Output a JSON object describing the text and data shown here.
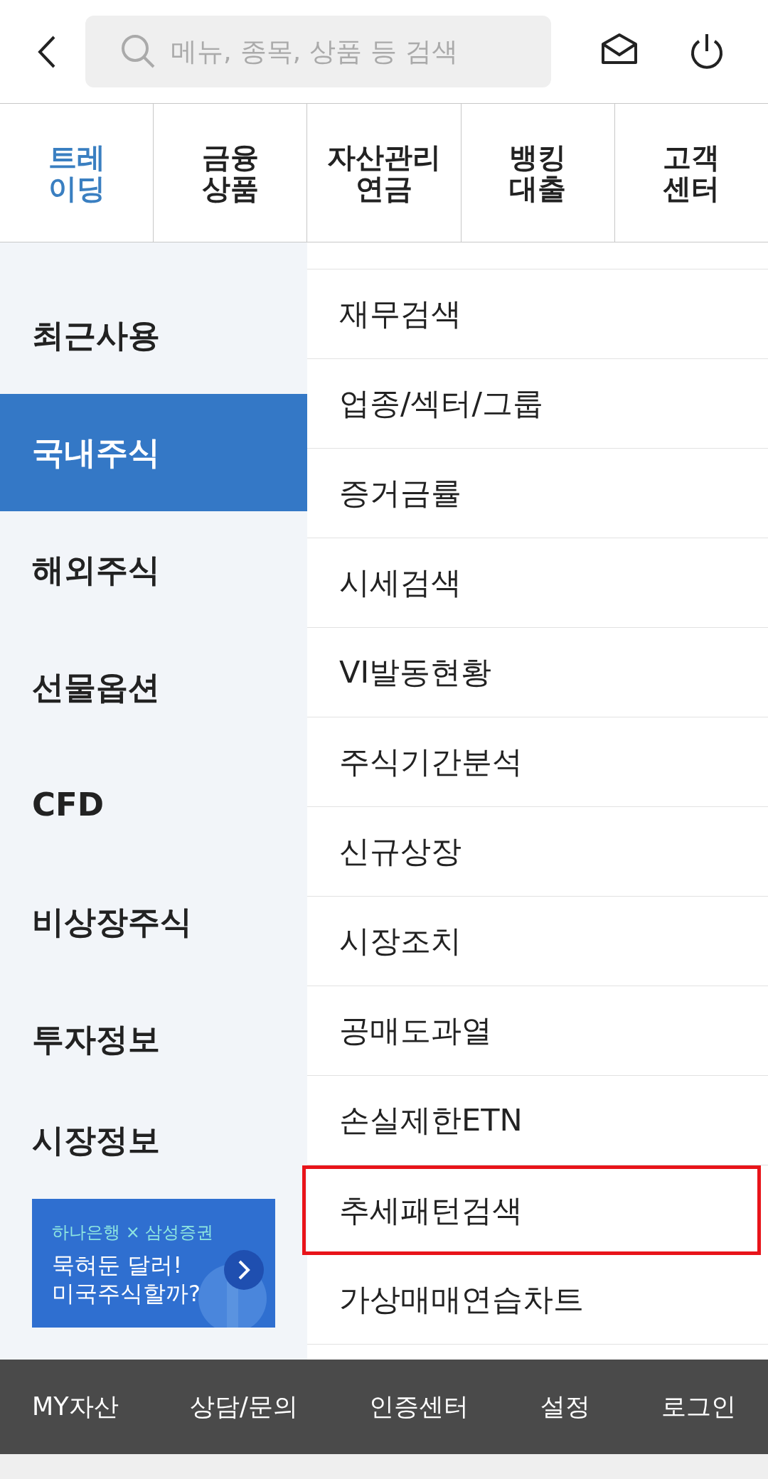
{
  "search": {
    "placeholder": "메뉴, 종목, 상품 등 검색"
  },
  "tabs": [
    {
      "lines": [
        "트레",
        "이딩"
      ],
      "selected": true
    },
    {
      "lines": [
        "금융",
        "상품"
      ],
      "selected": false
    },
    {
      "lines": [
        "자산관리",
        "연금"
      ],
      "selected": false
    },
    {
      "lines": [
        "뱅킹",
        "대출"
      ],
      "selected": false
    },
    {
      "lines": [
        "고객",
        "센터"
      ],
      "selected": false
    }
  ],
  "sidebar": {
    "items": [
      {
        "label": "최근사용",
        "selected": false
      },
      {
        "label": "국내주식",
        "selected": true
      },
      {
        "label": "해외주식",
        "selected": false
      },
      {
        "label": "선물옵션",
        "selected": false
      },
      {
        "label": "CFD",
        "selected": false
      },
      {
        "label": "비상장주식",
        "selected": false
      },
      {
        "label": "투자정보",
        "selected": false
      },
      {
        "label": "시장정보",
        "selected": false
      }
    ]
  },
  "banner": {
    "tagline": "하나은행 × 삼성증권",
    "headline": [
      "묵혀둔 달러!",
      "미국주식할까?"
    ]
  },
  "menu": {
    "items": [
      {
        "label": "재무검색",
        "highlighted": false
      },
      {
        "label": "업종/섹터/그룹",
        "highlighted": false
      },
      {
        "label": "증거금률",
        "highlighted": false
      },
      {
        "label": "시세검색",
        "highlighted": false
      },
      {
        "label": "VI발동현황",
        "highlighted": false
      },
      {
        "label": "주식기간분석",
        "highlighted": false
      },
      {
        "label": "신규상장",
        "highlighted": false
      },
      {
        "label": "시장조치",
        "highlighted": false
      },
      {
        "label": "공매도과열",
        "highlighted": false
      },
      {
        "label": "손실제한ETN",
        "highlighted": false
      },
      {
        "label": "추세패턴검색",
        "highlighted": true
      },
      {
        "label": "가상매매연습차트",
        "highlighted": false
      }
    ]
  },
  "footer": {
    "links": [
      "MY자산",
      "상담/문의",
      "인증센터",
      "설정",
      "로그인"
    ]
  }
}
